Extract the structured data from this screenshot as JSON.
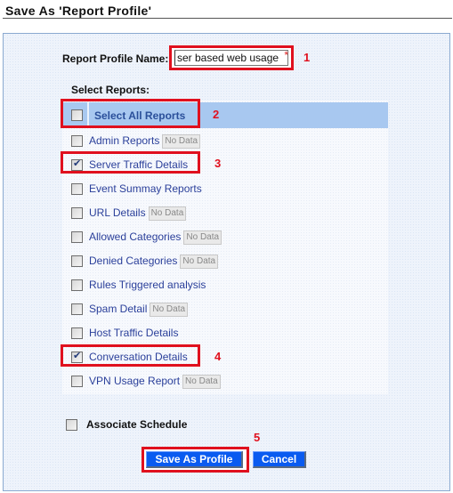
{
  "page": {
    "title": "Save  As 'Report Profile'"
  },
  "form": {
    "name_label": "Report Profile Name:",
    "name_value": "ser based web usage",
    "required_mark": "*",
    "select_reports_label": "Select Reports:",
    "select_all_label": "Select All Reports",
    "select_all_checked": false,
    "no_data_badge": "No Data",
    "reports": [
      {
        "label": "Admin Reports",
        "checked": false,
        "no_data": true
      },
      {
        "label": "Server Traffic Details",
        "checked": true,
        "no_data": false
      },
      {
        "label": "Event Summay Reports",
        "checked": false,
        "no_data": false
      },
      {
        "label": "URL Details",
        "checked": false,
        "no_data": true
      },
      {
        "label": "Allowed Categories",
        "checked": false,
        "no_data": true
      },
      {
        "label": "Denied Categories",
        "checked": false,
        "no_data": true
      },
      {
        "label": "Rules Triggered analysis",
        "checked": false,
        "no_data": false
      },
      {
        "label": "Spam Detail",
        "checked": false,
        "no_data": true
      },
      {
        "label": "Host Traffic Details",
        "checked": false,
        "no_data": false
      },
      {
        "label": "Conversation Details",
        "checked": true,
        "no_data": false
      },
      {
        "label": "VPN Usage Report",
        "checked": false,
        "no_data": true
      }
    ],
    "associate_schedule_label": "Associate Schedule",
    "associate_schedule_checked": false
  },
  "buttons": {
    "save_label": "Save As Profile",
    "cancel_label": "Cancel"
  },
  "annotations": [
    "1",
    "2",
    "3",
    "4",
    "5"
  ],
  "colors": {
    "highlight": "#e0101e",
    "button": "#0a5bf0",
    "select_all_bar": "#a8c8f0",
    "link_text": "#2a3f9a"
  }
}
